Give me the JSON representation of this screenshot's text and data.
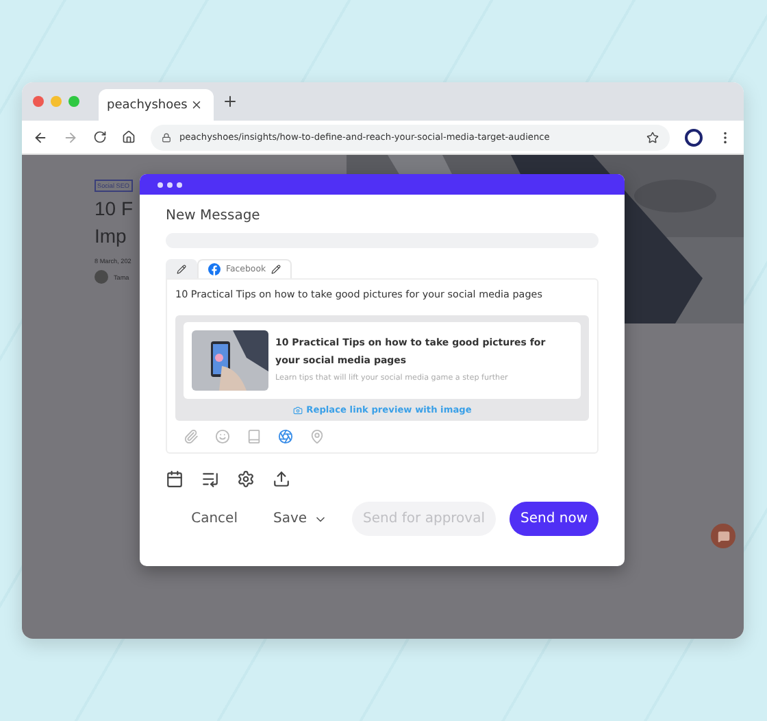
{
  "browser": {
    "tabs": [
      {
        "title": "peachyshoes",
        "selected": true
      }
    ],
    "url": "peachyshoes/insights/how-to-define-and-reach-your-social-media-target-audience"
  },
  "article": {
    "tag": "Social SEO",
    "title_lines": [
      "10 F",
      "Imp"
    ],
    "date": "8 March, 202",
    "author": "Tama"
  },
  "modal": {
    "title": "New Message",
    "channel_tabs": [
      {
        "kind": "edit",
        "selected": false
      },
      {
        "kind": "network",
        "label": "Facebook",
        "selected": true
      }
    ],
    "post_text": "10 Practical Tips on how to take good pictures for your social media pages",
    "link_preview": {
      "title": "10 Practical Tips on how to take good pictures for your social media pages",
      "description": "Learn tips that will lift your social media game a step further",
      "replace_link": "Replace link preview with image"
    },
    "tools": [
      {
        "kind": "attach",
        "active": false
      },
      {
        "kind": "emoji",
        "active": false
      },
      {
        "kind": "library",
        "active": false
      },
      {
        "kind": "badge",
        "active": true
      },
      {
        "kind": "location",
        "active": false
      }
    ],
    "options": [
      {
        "kind": "schedule"
      },
      {
        "kind": "queue"
      },
      {
        "kind": "settings"
      },
      {
        "kind": "upload"
      }
    ],
    "actions": {
      "cancel": "Cancel",
      "save": "Save",
      "approval": {
        "label": "Send for approval",
        "disabled": true
      },
      "send": "Send now"
    }
  }
}
